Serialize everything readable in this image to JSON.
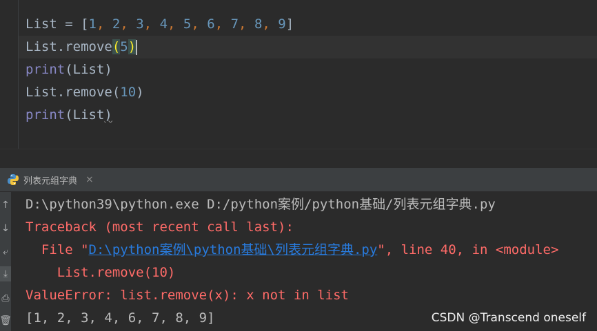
{
  "editor": {
    "line1": {
      "var": "List",
      "op": " = [",
      "items": [
        "1",
        "2",
        "3",
        "4",
        "5",
        "6",
        "7",
        "8",
        "9"
      ],
      "close": "]"
    },
    "line2": {
      "obj": "List.remove",
      "open": "(",
      "arg": "5",
      "close": ")"
    },
    "line3": {
      "fn": "print",
      "open": "(",
      "arg": "List",
      "close": ")"
    },
    "line4": {
      "obj": "List.remove",
      "open": "(",
      "arg": "10",
      "close": ")"
    },
    "line5": {
      "fn": "print",
      "open": "(",
      "arg": "List",
      "close": ")"
    }
  },
  "run_panel": {
    "tab_label": "列表元组字典",
    "tab_close": "×",
    "tab_icon": "python-icon"
  },
  "toolbar": {
    "icons": [
      "arrow-up-icon",
      "arrow-down-icon",
      "soft-wrap-icon",
      "scroll-to-end-icon",
      "print-icon",
      "trash-icon"
    ]
  },
  "console": {
    "cmd": "D:\\python39\\python.exe D:/python案例/python基础/列表元组字典.py",
    "traceback_header": "Traceback (most recent call last):",
    "file_prefix": "  File \"",
    "file_link": "D:\\python案例\\python基础\\列表元组字典.py",
    "file_suffix": "\", line 40, in <module>",
    "code_line": "    List.remove(10)",
    "error": "ValueError: list.remove(x): x not in list",
    "result": "[1, 2, 3, 4, 6, 7, 8, 9]"
  },
  "watermark": "CSDN @Transcend oneself",
  "colors": {
    "background": "#2b2b2b",
    "number": "#6897bb",
    "keyword": "#cc7832",
    "builtin": "#8888c6",
    "error": "#ff6b68",
    "link": "#287bde"
  }
}
